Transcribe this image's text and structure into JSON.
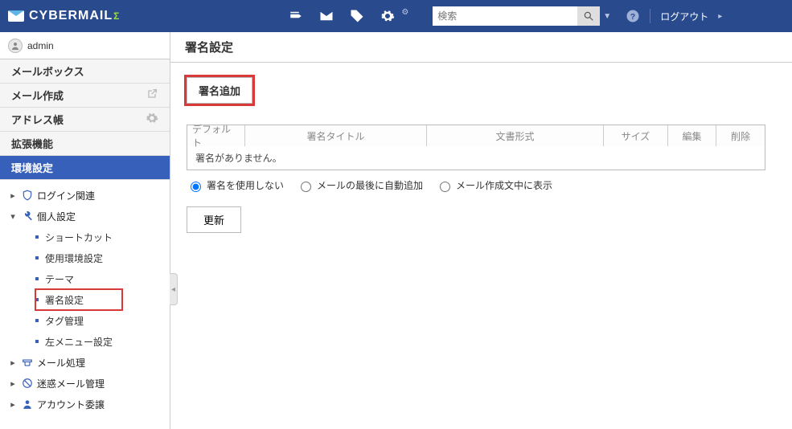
{
  "app_name": "CYBERMAIL",
  "header": {
    "search_placeholder": "検索",
    "logout_label": "ログアウト"
  },
  "user": {
    "name": "admin"
  },
  "sidebar": {
    "mailbox": "メールボックス",
    "compose": "メール作成",
    "address": "アドレス帳",
    "extensions": "拡張機能",
    "settings": "環境設定"
  },
  "tree": {
    "login": "ログイン関連",
    "personal": "個人設定",
    "personal_items": {
      "shortcut": "ショートカット",
      "env": "使用環境設定",
      "theme": "テーマ",
      "signature": "署名設定",
      "tag": "タグ管理",
      "leftmenu": "左メニュー設定"
    },
    "mailproc": "メール処理",
    "spam": "迷惑メール管理",
    "delegate": "アカウント委譲"
  },
  "page": {
    "title": "署名設定",
    "add_button": "署名追加",
    "columns": {
      "default": "デフォルト",
      "title": "署名タイトル",
      "format": "文書形式",
      "size": "サイズ",
      "edit": "編集",
      "delete": "削除"
    },
    "empty_message": "署名がありません。",
    "radio": {
      "none": "署名を使用しない",
      "append": "メールの最後に自動追加",
      "inline": "メール作成文中に表示"
    },
    "radio_selected": "none",
    "update_button": "更新"
  }
}
